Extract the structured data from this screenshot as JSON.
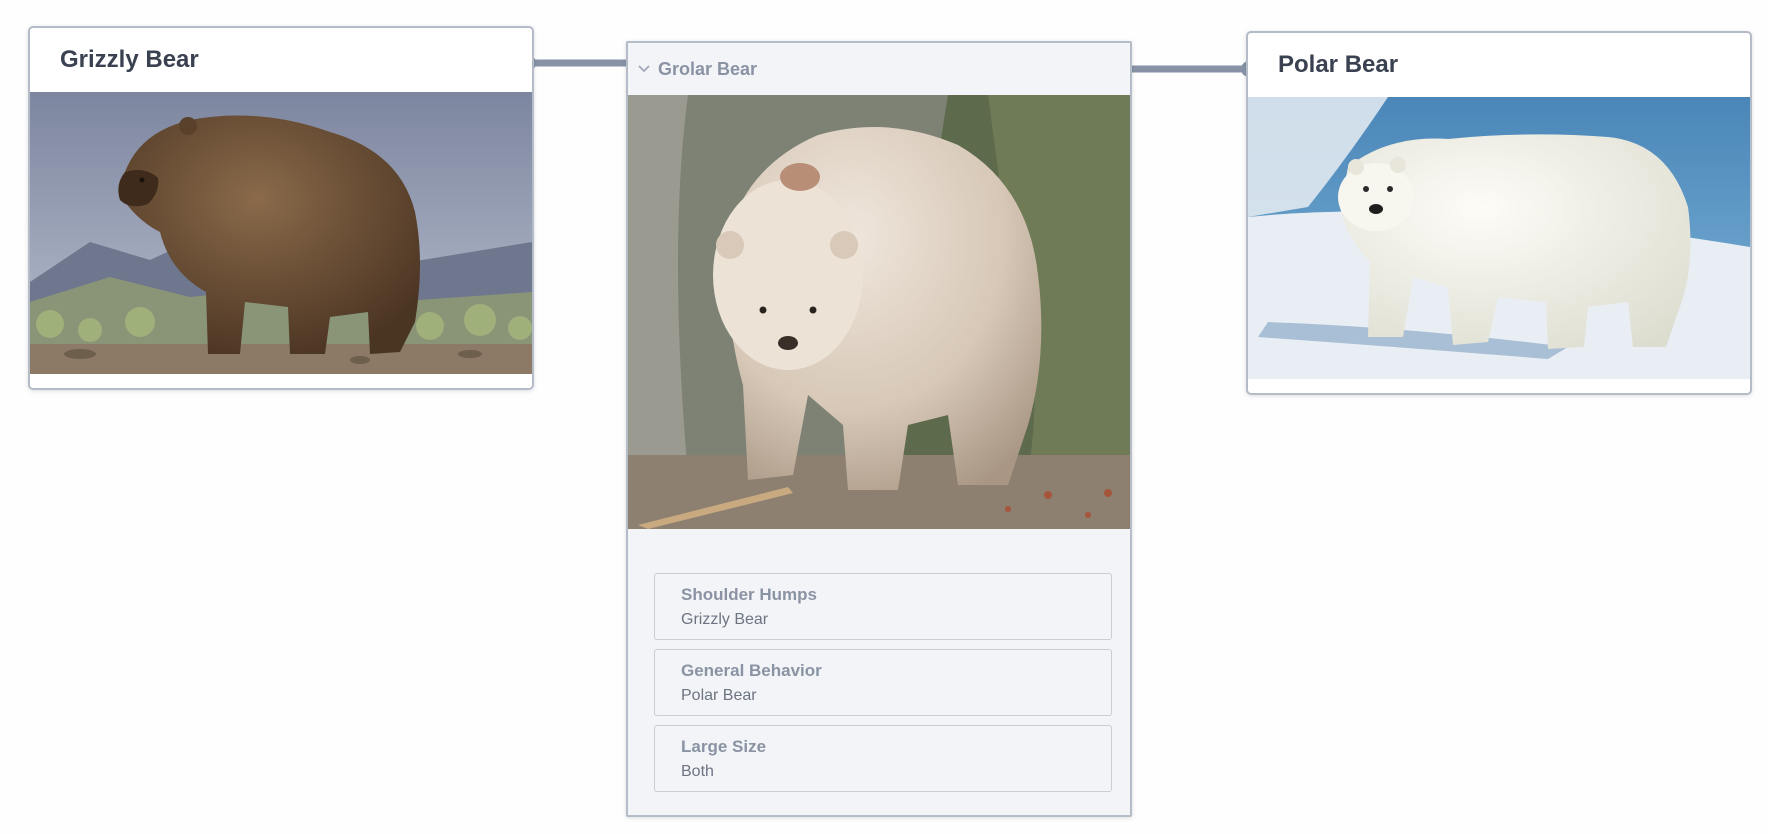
{
  "nodes": {
    "grizzly": {
      "title": "Grizzly Bear",
      "image": "grizzly-bear-photo"
    },
    "grolar": {
      "title": "Grolar Bear",
      "image": "grolar-bear-photo",
      "collapse_icon": "chevron-down-icon",
      "fields": [
        {
          "label": "Shoulder Humps",
          "value": "Grizzly Bear"
        },
        {
          "label": "General Behavior",
          "value": "Polar Bear"
        },
        {
          "label": "Large Size",
          "value": "Both"
        }
      ]
    },
    "polar": {
      "title": "Polar Bear",
      "image": "polar-bear-photo"
    }
  },
  "colors": {
    "edge": "#8792a6",
    "node_border": "#b4bcc8",
    "title_text": "#3a4150",
    "muted_text": "#8a93a3"
  }
}
